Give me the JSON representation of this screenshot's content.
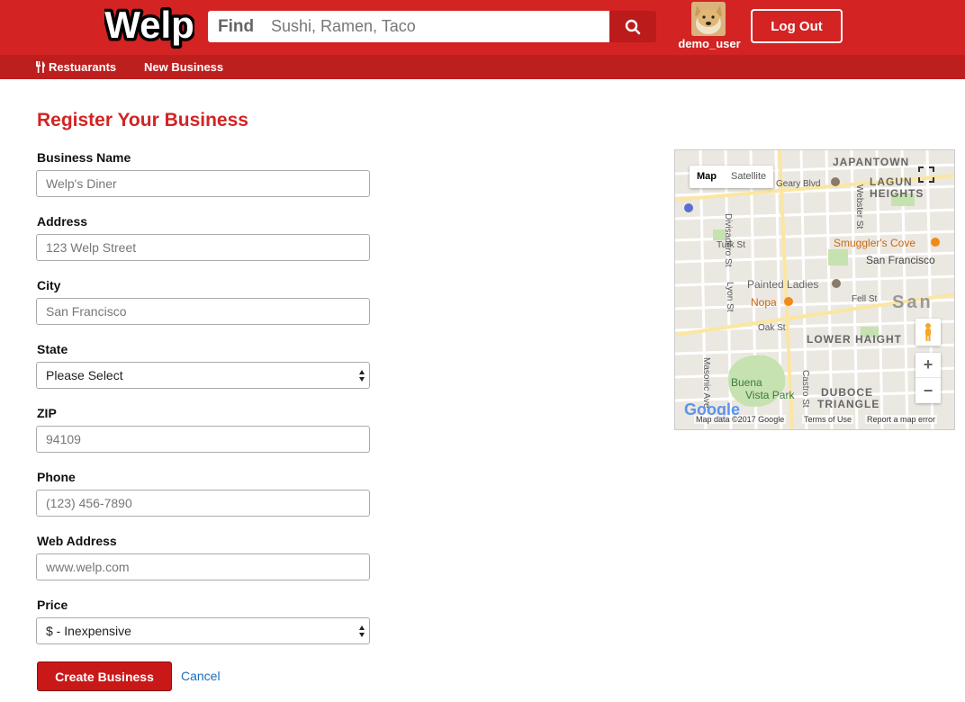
{
  "header": {
    "logo_text": "Welp",
    "find_label": "Find",
    "search_placeholder": "Sushi, Ramen, Taco",
    "username": "demo_user",
    "logout_label": "Log Out"
  },
  "subnav": {
    "items": [
      {
        "label": "Restuarants",
        "icon": "utensils-icon"
      },
      {
        "label": "New Business"
      }
    ]
  },
  "form": {
    "title": "Register Your Business",
    "fields": [
      {
        "label": "Business Name",
        "placeholder": "Welp's Diner"
      },
      {
        "label": "Address",
        "placeholder": "123 Welp Street"
      },
      {
        "label": "City",
        "placeholder": "San Francisco"
      },
      {
        "label": "State",
        "selected": "Please Select"
      },
      {
        "label": "ZIP",
        "placeholder": "94109"
      },
      {
        "label": "Phone",
        "placeholder": "(123) 456-7890"
      },
      {
        "label": "Web Address",
        "placeholder": "www.welp.com"
      },
      {
        "label": "Price",
        "selected": "$ - Inexpensive"
      }
    ],
    "create_label": "Create Business",
    "cancel_label": "Cancel"
  },
  "map": {
    "type_map": "Map",
    "type_satellite": "Satellite",
    "labels": {
      "japantown": "JAPANTOWN",
      "lagun": "LAGUN",
      "heights": "HEIGHTS",
      "geary": "Geary Blvd",
      "smugglers": "Smuggler's Cove",
      "san_francisco": "San Francisco",
      "turk": "Turk St",
      "painted_ladies": "Painted Ladies",
      "nopa": "Nopa",
      "fell": "Fell St",
      "oak": "Oak St",
      "lower_haight": "LOWER HAIGHT",
      "buena": "Buena",
      "vista_park": "Vista Park",
      "duboce": "DUBOCE",
      "triangle": "TRIANGLE",
      "san": "San",
      "divisadero": "Divisadero St",
      "webster": "Webster St",
      "lyon": "Lyon St",
      "masonic": "Masonic Ave",
      "castro": "Castro St"
    },
    "google": "Google",
    "attribution": "Map data ©2017 Google",
    "terms": "Terms of Use",
    "report": "Report a map error",
    "zoom_in": "+",
    "zoom_out": "−"
  },
  "colors": {
    "brand": "#d32323",
    "subnav": "#bd1f1f",
    "link": "#1a6fbd"
  }
}
